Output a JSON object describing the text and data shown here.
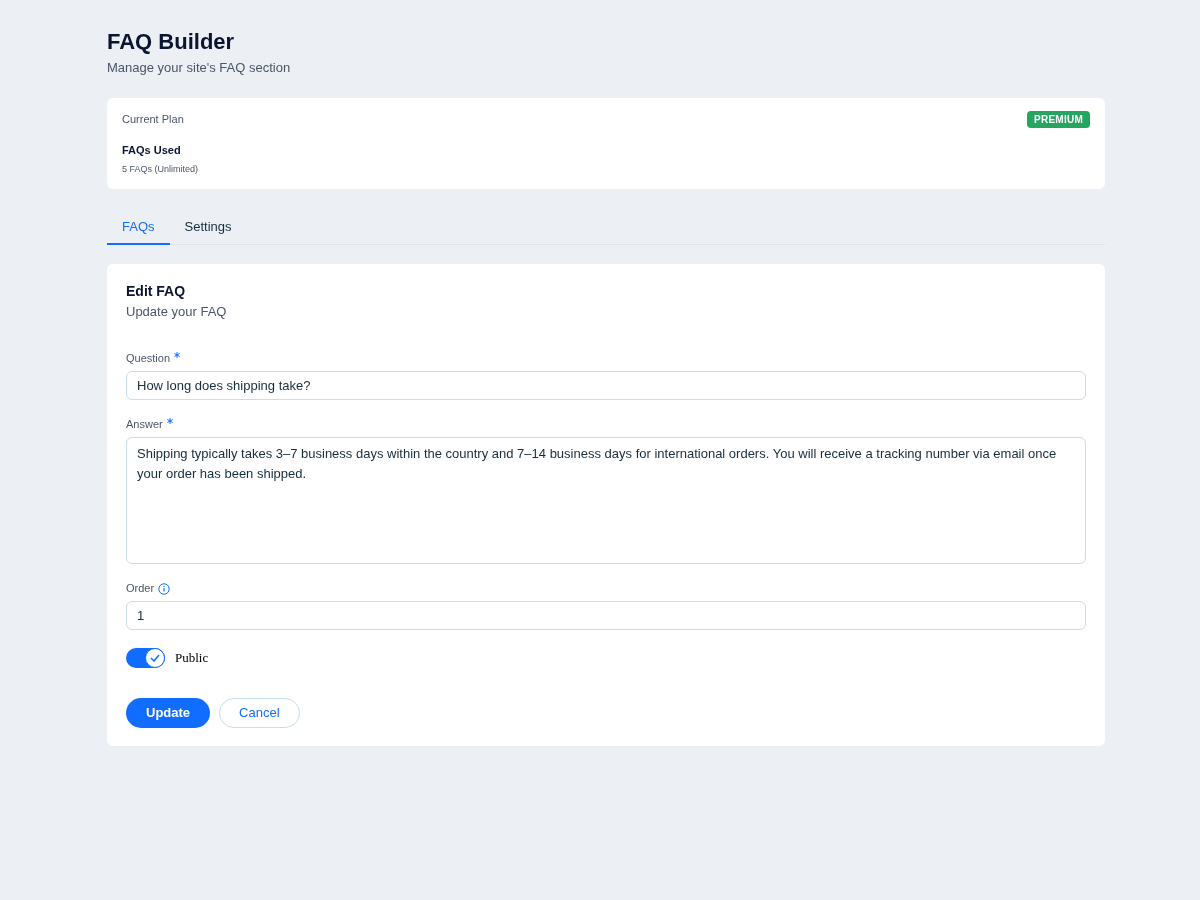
{
  "header": {
    "title": "FAQ Builder",
    "subtitle": "Manage your site's FAQ section"
  },
  "plan": {
    "label": "Current Plan",
    "badge": "PREMIUM",
    "usage_title": "FAQs Used",
    "usage_detail": "5 FAQs (Unlimited)"
  },
  "tabs": [
    {
      "label": "FAQs",
      "selected": true
    },
    {
      "label": "Settings",
      "selected": false
    }
  ],
  "form": {
    "title": "Edit FAQ",
    "subtitle": "Update your FAQ",
    "fields": [
      {
        "kind": "text",
        "label": "Question",
        "required": true,
        "info": false,
        "value": "How long does shipping take?"
      },
      {
        "kind": "textarea",
        "label": "Answer",
        "required": true,
        "info": false,
        "value": "Shipping typically takes 3–7 business days within the country and 7–14 business days for international orders. You will receive a tracking number via email once your order has been shipped."
      },
      {
        "kind": "text",
        "label": "Order",
        "required": false,
        "info": true,
        "value": "1"
      }
    ],
    "toggle": {
      "label": "Public",
      "on": true
    },
    "buttons": [
      {
        "kind": "primary",
        "label": "Update"
      },
      {
        "kind": "secondary",
        "label": "Cancel"
      }
    ]
  }
}
